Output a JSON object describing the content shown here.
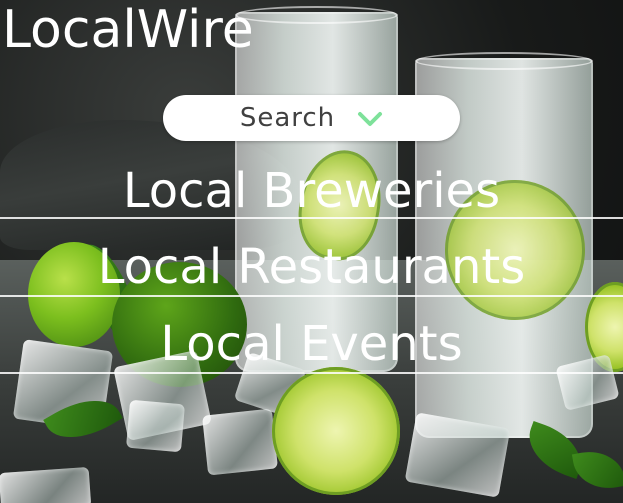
{
  "brand": {
    "name": "LocalWire"
  },
  "search": {
    "label": "Search",
    "icon": "chevron-down-icon",
    "icon_color": "#7ee19a"
  },
  "nav": {
    "items": [
      {
        "label": "Local Breweries"
      },
      {
        "label": "Local Restaurants"
      },
      {
        "label": "Local Events"
      }
    ]
  },
  "colors": {
    "text": "#ffffff",
    "search_bg": "#ffffff",
    "search_text": "#404040"
  }
}
